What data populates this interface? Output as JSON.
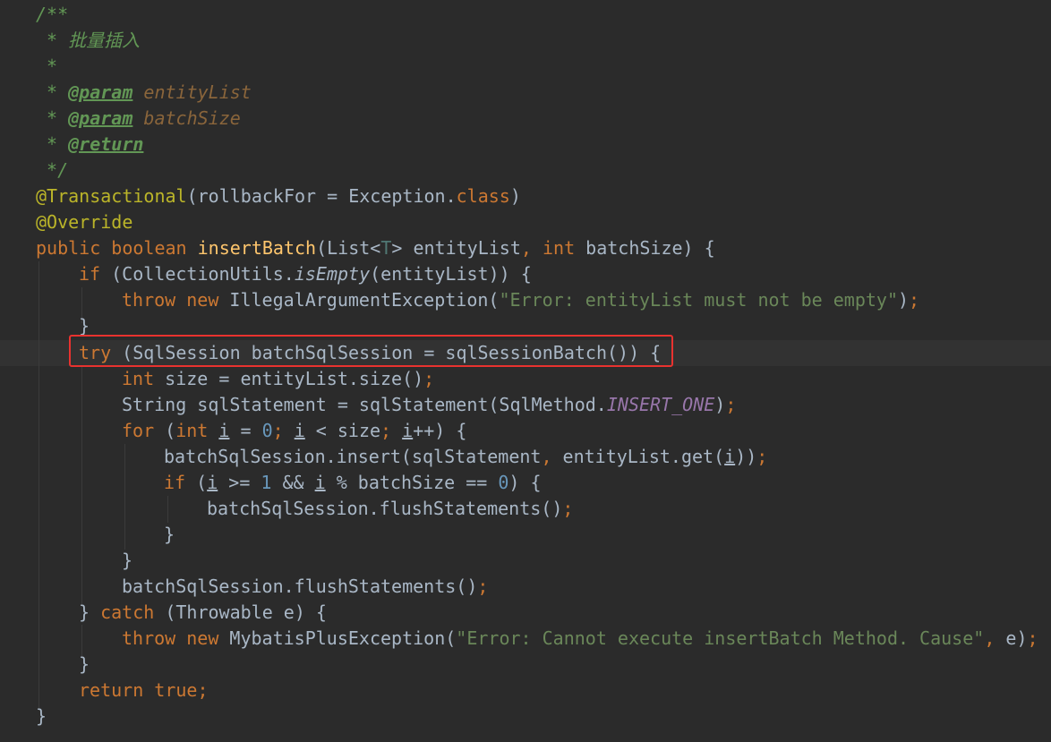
{
  "colors": {
    "background": "#2b2b2b",
    "current_line": "#323232",
    "keyword": "#cc7832",
    "comment": "#629755",
    "string": "#6a8759",
    "number": "#6897bb",
    "method_declaration": "#ffc66d",
    "annotation": "#bbb529",
    "constant": "#9876aa",
    "highlight_box": "#e8322f"
  },
  "code": {
    "c1": "/**",
    "c2": " * 批量插入",
    "c3": " *",
    "c4_star": " * ",
    "c4_tag": "@param",
    "c4_name": "entityList",
    "c5_star": " * ",
    "c5_tag": "@param",
    "c5_name": "batchSize",
    "c6_star": " * ",
    "c6_tag": "@return",
    "c7": " */",
    "l8_anno": "@Transactional",
    "l8_open": "(rollbackFor = Exception.",
    "l8_class": "class",
    "l8_close": ")",
    "l9_anno": "@Override",
    "l10_public": "public",
    "l10_boolean": "boolean",
    "l10_name": "insertBatch",
    "l10_a": "(List<",
    "l10_t": "T",
    "l10_b": "> entityList",
    "l10_comma": ",",
    "l10_int": "int",
    "l10_c": " batchSize) {",
    "l11_if": "if",
    "l11_a": " (CollectionUtils.",
    "l11_isEmpty": "isEmpty",
    "l11_b": "(entityList)) {",
    "l12_throw": "throw",
    "l12_new": "new",
    "l12_a": " IllegalArgumentException(",
    "l12_str": "\"Error: entityList must not be empty\"",
    "l12_b": ")",
    "l12_semi": ";",
    "l13": "}",
    "l14_try": "try",
    "l14_a": " (SqlSession batchSqlSession = sqlSessionBatch()) {",
    "l15_int": "int",
    "l15_a": " size = entityList.size()",
    "l15_semi": ";",
    "l16_a": "String sqlStatement = sqlStatement(SqlMethod.",
    "l16_const": "INSERT_ONE",
    "l16_b": ")",
    "l16_semi": ";",
    "l17_for": "for",
    "l17_a": " (",
    "l17_int": "int",
    "l17_i1": "i",
    "l17_b": " = ",
    "l17_zero": "0",
    "l17_s1": ";",
    "l17_i2": "i",
    "l17_c": " < size",
    "l17_s2": ";",
    "l17_i3": "i",
    "l17_d": "++) {",
    "l18_a": "batchSqlSession.insert(sqlStatement",
    "l18_comma": ",",
    "l18_b": " entityList.get(",
    "l18_i": "i",
    "l18_c": "))",
    "l18_semi": ";",
    "l19_if": "if",
    "l19_a": " (",
    "l19_i1": "i",
    "l19_b": " >= ",
    "l19_one": "1",
    "l19_c": " && ",
    "l19_i2": "i",
    "l19_d": " % batchSize == ",
    "l19_zero": "0",
    "l19_e": ") {",
    "l20_a": "batchSqlSession.flushStatements()",
    "l20_semi": ";",
    "l21": "}",
    "l22": "}",
    "l23_a": "batchSqlSession.flushStatements()",
    "l23_semi": ";",
    "l24_a": "} ",
    "l24_catch": "catch",
    "l24_b": " (Throwable e) {",
    "l25_throw": "throw",
    "l25_new": "new",
    "l25_a": " MybatisPlusException(",
    "l25_str": "\"Error: Cannot execute insertBatch Method. Cause\"",
    "l25_comma": ",",
    "l25_b": " e)",
    "l25_semi": ";",
    "l26": "}",
    "l27_return": "return",
    "l27_true": "true;",
    "l28": "}"
  }
}
